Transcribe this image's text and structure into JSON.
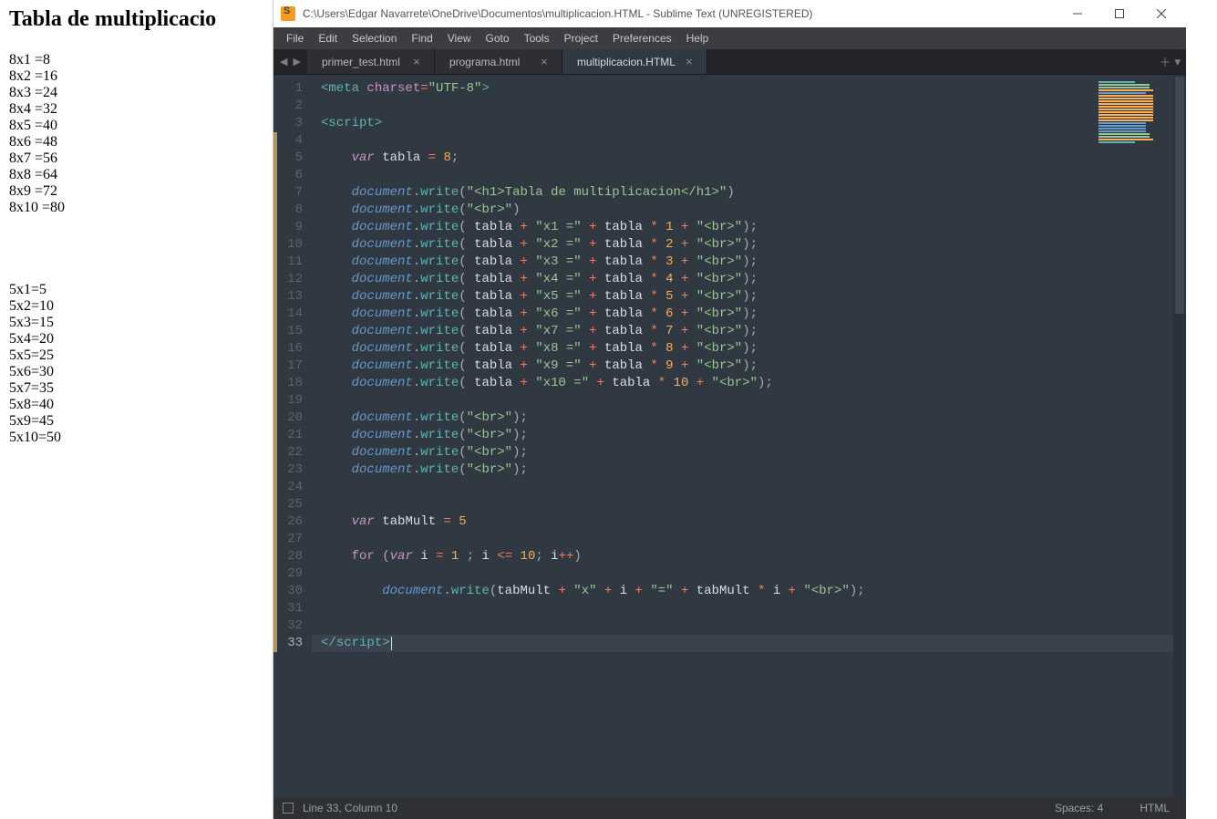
{
  "browser": {
    "heading": "Tabla de multiplicacio",
    "table8": [
      "8x1 =8",
      "8x2 =16",
      "8x3 =24",
      "8x4 =32",
      "8x5 =40",
      "8x6 =48",
      "8x7 =56",
      "8x8 =64",
      "8x9 =72",
      "8x10 =80"
    ],
    "table5": [
      "5x1=5",
      "5x2=10",
      "5x3=15",
      "5x4=20",
      "5x5=25",
      "5x6=30",
      "5x7=35",
      "5x8=40",
      "5x9=45",
      "5x10=50"
    ]
  },
  "window": {
    "title": "C:\\Users\\Edgar Navarrete\\OneDrive\\Documentos\\multiplicacion.HTML - Sublime Text (UNREGISTERED)"
  },
  "menu": [
    "File",
    "Edit",
    "Selection",
    "Find",
    "View",
    "Goto",
    "Tools",
    "Project",
    "Preferences",
    "Help"
  ],
  "tabs": [
    {
      "label": "primer_test.html",
      "active": false
    },
    {
      "label": "programa.html",
      "active": false
    },
    {
      "label": "multiplicacion.HTML",
      "active": true
    }
  ],
  "code_lines": [
    {
      "n": 1,
      "html": "<span class='br'>&lt;</span><span class='t'>meta</span> <span class='a'>charset</span><span class='eq'>=</span><span class='s'>\"UTF-8\"</span><span class='br'>&gt;</span>"
    },
    {
      "n": 2,
      "html": ""
    },
    {
      "n": 3,
      "html": "<span class='br'>&lt;</span><span class='t'>script</span><span class='br'>&gt;</span>"
    },
    {
      "n": 4,
      "html": ""
    },
    {
      "n": 5,
      "html": "    <span class='ki'>var</span> <span class='v'>tabla</span> <span class='o'>=</span> <span class='n'>8</span><span class='p'>;</span>"
    },
    {
      "n": 6,
      "html": ""
    },
    {
      "n": 7,
      "html": "    <span class='ob'>document</span><span class='p'>.</span><span class='fn'>write</span><span class='p'>(</span><span class='s'>\"&lt;h1&gt;Tabla de multiplicacion&lt;/h1&gt;\"</span><span class='p'>)</span>"
    },
    {
      "n": 8,
      "html": "    <span class='ob'>document</span><span class='p'>.</span><span class='fn'>write</span><span class='p'>(</span><span class='s'>\"&lt;br&gt;\"</span><span class='p'>)</span>"
    },
    {
      "n": 9,
      "html": "    <span class='ob'>document</span><span class='p'>.</span><span class='fn'>write</span><span class='p'>(</span> <span class='v'>tabla</span> <span class='o'>+</span> <span class='s'>\"x1 =\"</span> <span class='o'>+</span> <span class='v'>tabla</span> <span class='o'>*</span> <span class='n'>1</span> <span class='o'>+</span> <span class='s'>\"&lt;br&gt;\"</span><span class='p'>);</span>"
    },
    {
      "n": 10,
      "html": "    <span class='ob'>document</span><span class='p'>.</span><span class='fn'>write</span><span class='p'>(</span> <span class='v'>tabla</span> <span class='o'>+</span> <span class='s'>\"x2 =\"</span> <span class='o'>+</span> <span class='v'>tabla</span> <span class='o'>*</span> <span class='n'>2</span> <span class='o'>+</span> <span class='s'>\"&lt;br&gt;\"</span><span class='p'>);</span>"
    },
    {
      "n": 11,
      "html": "    <span class='ob'>document</span><span class='p'>.</span><span class='fn'>write</span><span class='p'>(</span> <span class='v'>tabla</span> <span class='o'>+</span> <span class='s'>\"x3 =\"</span> <span class='o'>+</span> <span class='v'>tabla</span> <span class='o'>*</span> <span class='n'>3</span> <span class='o'>+</span> <span class='s'>\"&lt;br&gt;\"</span><span class='p'>);</span>"
    },
    {
      "n": 12,
      "html": "    <span class='ob'>document</span><span class='p'>.</span><span class='fn'>write</span><span class='p'>(</span> <span class='v'>tabla</span> <span class='o'>+</span> <span class='s'>\"x4 =\"</span> <span class='o'>+</span> <span class='v'>tabla</span> <span class='o'>*</span> <span class='n'>4</span> <span class='o'>+</span> <span class='s'>\"&lt;br&gt;\"</span><span class='p'>);</span>"
    },
    {
      "n": 13,
      "html": "    <span class='ob'>document</span><span class='p'>.</span><span class='fn'>write</span><span class='p'>(</span> <span class='v'>tabla</span> <span class='o'>+</span> <span class='s'>\"x5 =\"</span> <span class='o'>+</span> <span class='v'>tabla</span> <span class='o'>*</span> <span class='n'>5</span> <span class='o'>+</span> <span class='s'>\"&lt;br&gt;\"</span><span class='p'>);</span>"
    },
    {
      "n": 14,
      "html": "    <span class='ob'>document</span><span class='p'>.</span><span class='fn'>write</span><span class='p'>(</span> <span class='v'>tabla</span> <span class='o'>+</span> <span class='s'>\"x6 =\"</span> <span class='o'>+</span> <span class='v'>tabla</span> <span class='o'>*</span> <span class='n'>6</span> <span class='o'>+</span> <span class='s'>\"&lt;br&gt;\"</span><span class='p'>);</span>"
    },
    {
      "n": 15,
      "html": "    <span class='ob'>document</span><span class='p'>.</span><span class='fn'>write</span><span class='p'>(</span> <span class='v'>tabla</span> <span class='o'>+</span> <span class='s'>\"x7 =\"</span> <span class='o'>+</span> <span class='v'>tabla</span> <span class='o'>*</span> <span class='n'>7</span> <span class='o'>+</span> <span class='s'>\"&lt;br&gt;\"</span><span class='p'>);</span>"
    },
    {
      "n": 16,
      "html": "    <span class='ob'>document</span><span class='p'>.</span><span class='fn'>write</span><span class='p'>(</span> <span class='v'>tabla</span> <span class='o'>+</span> <span class='s'>\"x8 =\"</span> <span class='o'>+</span> <span class='v'>tabla</span> <span class='o'>*</span> <span class='n'>8</span> <span class='o'>+</span> <span class='s'>\"&lt;br&gt;\"</span><span class='p'>);</span>"
    },
    {
      "n": 17,
      "html": "    <span class='ob'>document</span><span class='p'>.</span><span class='fn'>write</span><span class='p'>(</span> <span class='v'>tabla</span> <span class='o'>+</span> <span class='s'>\"x9 =\"</span> <span class='o'>+</span> <span class='v'>tabla</span> <span class='o'>*</span> <span class='n'>9</span> <span class='o'>+</span> <span class='s'>\"&lt;br&gt;\"</span><span class='p'>);</span>"
    },
    {
      "n": 18,
      "html": "    <span class='ob'>document</span><span class='p'>.</span><span class='fn'>write</span><span class='p'>(</span> <span class='v'>tabla</span> <span class='o'>+</span> <span class='s'>\"x10 =\"</span> <span class='o'>+</span> <span class='v'>tabla</span> <span class='o'>*</span> <span class='n'>10</span> <span class='o'>+</span> <span class='s'>\"&lt;br&gt;\"</span><span class='p'>);</span>"
    },
    {
      "n": 19,
      "html": ""
    },
    {
      "n": 20,
      "html": "    <span class='ob'>document</span><span class='p'>.</span><span class='fn'>write</span><span class='p'>(</span><span class='s'>\"&lt;br&gt;\"</span><span class='p'>);</span>"
    },
    {
      "n": 21,
      "html": "    <span class='ob'>document</span><span class='p'>.</span><span class='fn'>write</span><span class='p'>(</span><span class='s'>\"&lt;br&gt;\"</span><span class='p'>);</span>"
    },
    {
      "n": 22,
      "html": "    <span class='ob'>document</span><span class='p'>.</span><span class='fn'>write</span><span class='p'>(</span><span class='s'>\"&lt;br&gt;\"</span><span class='p'>);</span>"
    },
    {
      "n": 23,
      "html": "    <span class='ob'>document</span><span class='p'>.</span><span class='fn'>write</span><span class='p'>(</span><span class='s'>\"&lt;br&gt;\"</span><span class='p'>);</span>"
    },
    {
      "n": 24,
      "html": ""
    },
    {
      "n": 25,
      "html": ""
    },
    {
      "n": 26,
      "html": "    <span class='ki'>var</span> <span class='v'>tabMult</span> <span class='o'>=</span> <span class='n'>5</span>"
    },
    {
      "n": 27,
      "html": ""
    },
    {
      "n": 28,
      "html": "    <span class='k'>for</span> <span class='p'>(</span><span class='ki'>var</span> <span class='v'>i</span> <span class='o'>=</span> <span class='n'>1</span> <span class='p'>;</span> <span class='v'>i</span> <span class='o'>&lt;=</span> <span class='n'>10</span><span class='p'>;</span> <span class='v'>i</span><span class='o'>++</span><span class='p'>)</span>"
    },
    {
      "n": 29,
      "html": ""
    },
    {
      "n": 30,
      "html": "        <span class='ob'>document</span><span class='p'>.</span><span class='fn'>write</span><span class='p'>(</span><span class='v'>tabMult</span> <span class='o'>+</span> <span class='s'>\"x\"</span> <span class='o'>+</span> <span class='v'>i</span> <span class='o'>+</span> <span class='s'>\"=\"</span> <span class='o'>+</span> <span class='v'>tabMult</span> <span class='o'>*</span> <span class='v'>i</span> <span class='o'>+</span> <span class='s'>\"&lt;br&gt;\"</span><span class='p'>);</span>"
    },
    {
      "n": 31,
      "html": ""
    },
    {
      "n": 32,
      "html": ""
    },
    {
      "n": 33,
      "html": "<span class='br'>&lt;/</span><span class='t'>script</span><span class='br'>&gt;</span><span class='caret'></span>",
      "current": true
    }
  ],
  "modified_lines": [
    4,
    5,
    6,
    7,
    8,
    9,
    10,
    11,
    12,
    13,
    14,
    15,
    16,
    17,
    18,
    19,
    20,
    21,
    22,
    23,
    24,
    25,
    26,
    27,
    28,
    29,
    30,
    31,
    32,
    33
  ],
  "status": {
    "cursor": "Line 33, Column 10",
    "spaces": "Spaces: 4",
    "lang": "HTML"
  }
}
